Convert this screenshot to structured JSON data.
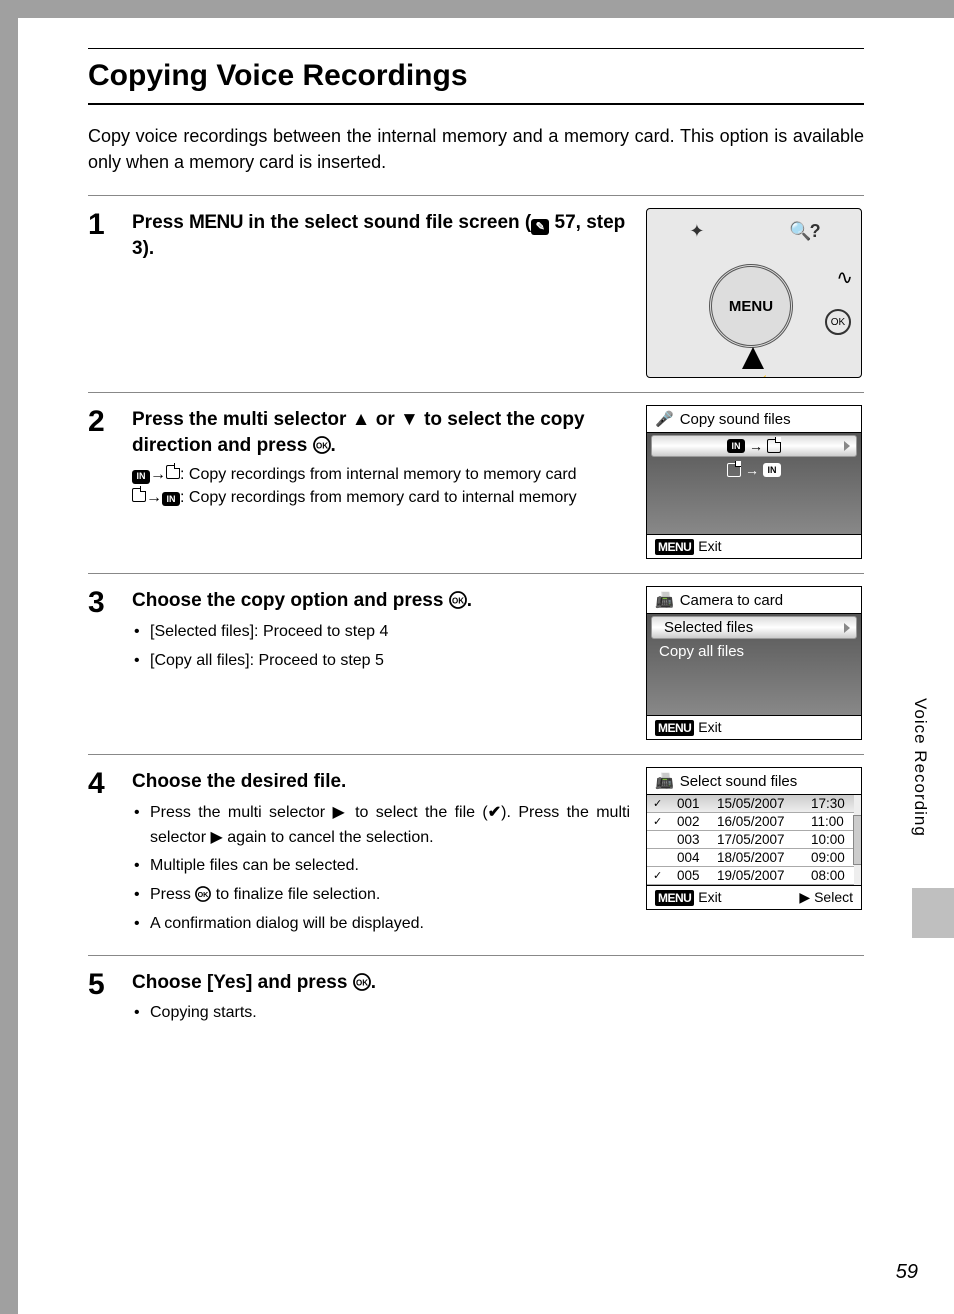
{
  "title": "Copying Voice Recordings",
  "intro": "Copy voice recordings between the internal memory and a memory card. This option is available only when a memory card is inserted.",
  "side_tab": "Voice Recording",
  "page_number": "59",
  "menu_label": "MENU",
  "exit_label": "Exit",
  "select_label": "Select",
  "steps": {
    "s1": {
      "num": "1",
      "head_a": "Press ",
      "head_b": " in the select sound file screen (",
      "head_c": " 57, step 3).",
      "cam_center": "MENU"
    },
    "s2": {
      "num": "2",
      "head": "Press the multi selector ▲ or ▼ to select the copy direction and press ",
      "head_end": ".",
      "detail_a": ": Copy recordings from internal memory to memory card",
      "detail_b": ": Copy recordings from memory card to internal memory",
      "lcd_title": "Copy sound files"
    },
    "s3": {
      "num": "3",
      "head": "Choose the copy option and press ",
      "head_end": ".",
      "bul_a": "[Selected files]: Proceed to step 4",
      "bul_b": "[Copy all files]: Proceed to step 5",
      "lcd_title": "Camera to card",
      "opt_a": "Selected files",
      "opt_b": "Copy all files"
    },
    "s4": {
      "num": "4",
      "head": "Choose the desired file.",
      "bul_a_1": "Press the multi selector ▶ to select the file (",
      "bul_a_2": "). Press the multi selector ▶ again to cancel the selection.",
      "bul_b": "Multiple files can be selected.",
      "bul_c_1": "Press ",
      "bul_c_2": " to finalize file selection.",
      "bul_d": "A confirmation dialog will be displayed.",
      "lcd_title": "Select sound files",
      "files": [
        {
          "mark": "✓",
          "idx": "001",
          "date": "15/05/2007",
          "time": "17:30",
          "sel": true
        },
        {
          "mark": "✓",
          "idx": "002",
          "date": "16/05/2007",
          "time": "11:00",
          "sel": false
        },
        {
          "mark": "",
          "idx": "003",
          "date": "17/05/2007",
          "time": "10:00",
          "sel": false
        },
        {
          "mark": "",
          "idx": "004",
          "date": "18/05/2007",
          "time": "09:00",
          "sel": false
        },
        {
          "mark": "✓",
          "idx": "005",
          "date": "19/05/2007",
          "time": "08:00",
          "sel": false
        }
      ]
    },
    "s5": {
      "num": "5",
      "head": "Choose [Yes] and press ",
      "head_end": ".",
      "bul_a": "Copying starts."
    }
  }
}
